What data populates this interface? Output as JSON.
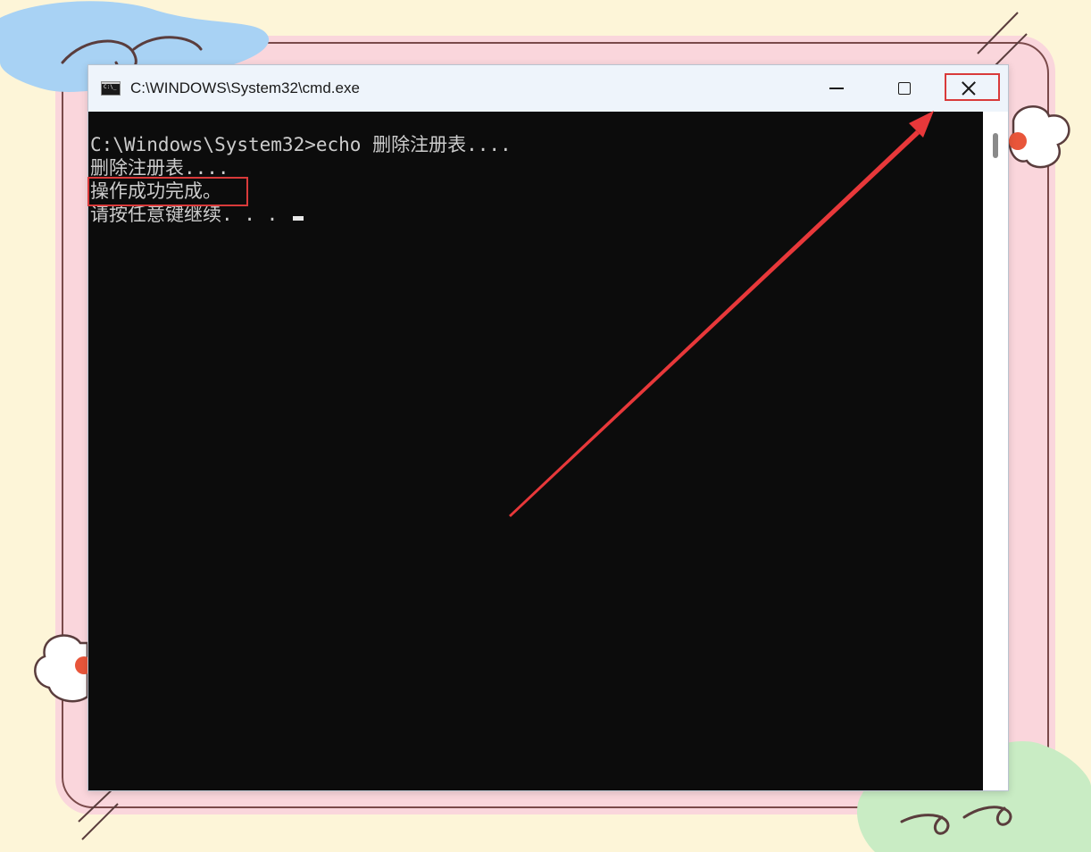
{
  "window": {
    "title": "C:\\WINDOWS\\System32\\cmd.exe",
    "icon_text": "C:\\_"
  },
  "console": {
    "lines": [
      "C:\\Windows\\System32>echo 删除注册表....",
      "删除注册表....",
      "操作成功完成。",
      "请按任意键继续. . . "
    ]
  },
  "annotations": {
    "highlight_color": "#d93a3a",
    "arrow_color": "#e8383a"
  },
  "colors": {
    "background": "#fdf5d8",
    "frame_pink": "#fad6dc",
    "console_bg": "#0c0c0c",
    "console_text": "#cccccc",
    "titlebar": "#eef4fb"
  }
}
